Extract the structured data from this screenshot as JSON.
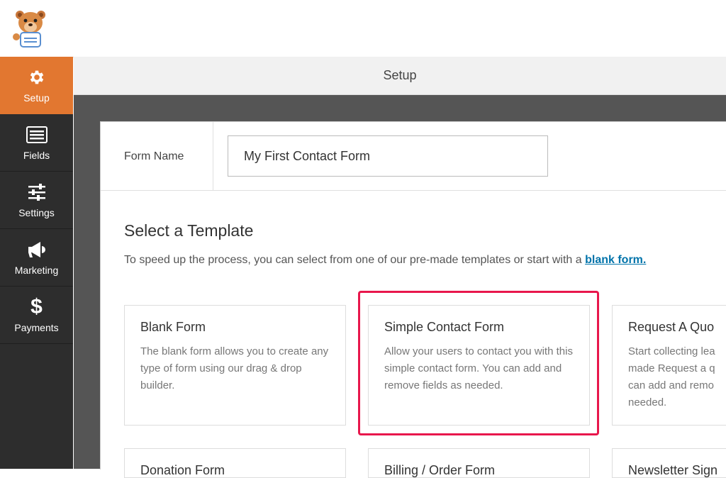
{
  "header": {
    "logo_name": "wpforms-bear-logo",
    "title": "Setup"
  },
  "sidebar": {
    "items": [
      {
        "label": "Setup",
        "icon": "gear-icon",
        "active": true
      },
      {
        "label": "Fields",
        "icon": "fields-list-icon",
        "active": false
      },
      {
        "label": "Settings",
        "icon": "sliders-icon",
        "active": false
      },
      {
        "label": "Marketing",
        "icon": "megaphone-icon",
        "active": false
      },
      {
        "label": "Payments",
        "icon": "dollar-icon",
        "active": false
      }
    ]
  },
  "form": {
    "name_label": "Form Name",
    "name_value": "My First Contact Form"
  },
  "templates": {
    "heading": "Select a Template",
    "description_prefix": "To speed up the process, you can select from one of our pre-made templates or start with a ",
    "description_link": "blank form.",
    "cards": [
      {
        "title": "Blank Form",
        "desc": "The blank form allows you to create any type of form using our drag & drop builder."
      },
      {
        "title": "Simple Contact Form",
        "desc": "Allow your users to contact you with this simple contact form. You can add and remove fields as needed."
      },
      {
        "title": "Request A Quo",
        "desc": "Start collecting lea made Request a q can add and remo needed."
      },
      {
        "title": "Donation Form",
        "desc": ""
      },
      {
        "title": "Billing / Order Form",
        "desc": ""
      },
      {
        "title": "Newsletter Sign",
        "desc": ""
      }
    ]
  },
  "colors": {
    "accent_orange": "#e27730",
    "sidebar_bg": "#2d2d2d",
    "highlight_red": "#e8174c",
    "link_blue": "#0073aa"
  }
}
